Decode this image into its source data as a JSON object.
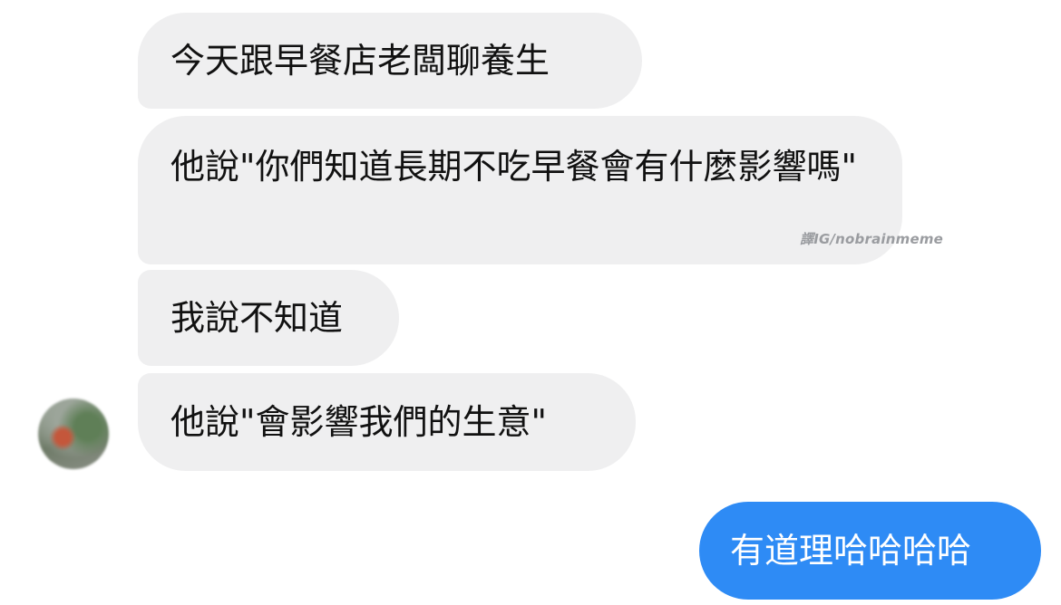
{
  "messages": [
    {
      "direction": "incoming",
      "text": "今天跟早餐店老闆聊養生"
    },
    {
      "direction": "incoming",
      "text": "他說\"你們知道長期不吃早餐會有什麼影響嗎\""
    },
    {
      "direction": "incoming",
      "text": "我說不知道"
    },
    {
      "direction": "incoming",
      "text": "他說\"會影響我們的生意\""
    },
    {
      "direction": "outgoing",
      "text": "有道理哈哈哈哈"
    }
  ],
  "watermark": "譯IG/nobrainmeme",
  "colors": {
    "incoming_bubble": "#efeff0",
    "outgoing_bubble": "#2e8bf5",
    "incoming_text": "#111111",
    "outgoing_text": "#ffffff"
  }
}
